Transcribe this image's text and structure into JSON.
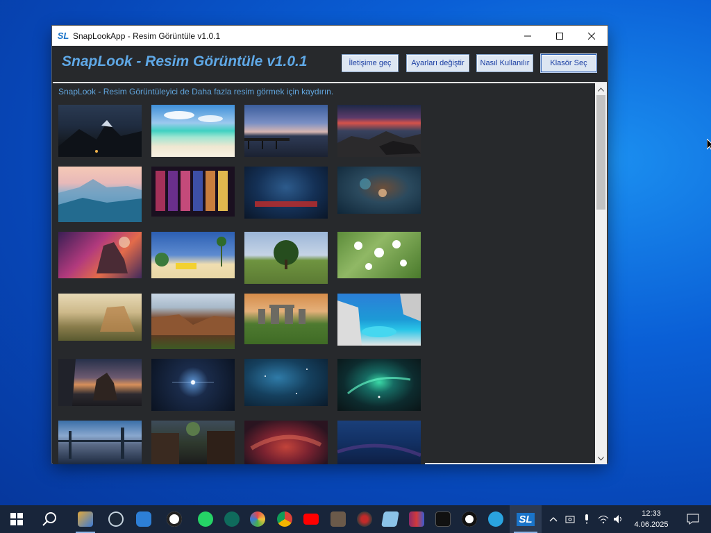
{
  "window": {
    "title": "SnapLookApp - Resim Görüntüle v1.0.1",
    "icon_text": "SL"
  },
  "header": {
    "title": "SnapLook - Resim Görüntüle v1.0.1",
    "buttons": {
      "contact": "İletişime geç",
      "settings": "Ayarları değiştir",
      "howto": "Nasıl Kullanılır",
      "folder": "Klasör Seç"
    }
  },
  "content": {
    "info_text": "SnapLook - Resim Görüntüleyici de Daha fazla resim görmek için kaydırın."
  },
  "gallery": [
    {
      "name": "mountain-night-image"
    },
    {
      "name": "tropical-beach-image"
    },
    {
      "name": "pier-sunset-image"
    },
    {
      "name": "rocky-shore-sunset-image"
    },
    {
      "name": "misty-mountains-image"
    },
    {
      "name": "neon-doors-image"
    },
    {
      "name": "blue-abyss-image"
    },
    {
      "name": "space-nebula-figure-image"
    },
    {
      "name": "fantasy-planet-image"
    },
    {
      "name": "palm-beach-car-image"
    },
    {
      "name": "green-tree-field-image"
    },
    {
      "name": "white-blossoms-image"
    },
    {
      "name": "canyon-painting-image"
    },
    {
      "name": "red-canyon-image"
    },
    {
      "name": "stonehenge-image"
    },
    {
      "name": "navagio-beach-image"
    },
    {
      "name": "dragon-canyon-image"
    },
    {
      "name": "blue-star-image"
    },
    {
      "name": "dark-nebula-image"
    },
    {
      "name": "green-nebula-image"
    },
    {
      "name": "futuristic-city-image"
    },
    {
      "name": "old-town-street-image"
    },
    {
      "name": "red-nebula-image"
    },
    {
      "name": "deep-blue-space-image"
    }
  ],
  "taskbar": {
    "time": "12:33",
    "date": "4.06.2025"
  },
  "colors": {
    "app_bg": "#27292c",
    "accent": "#5fa8e6",
    "button_bg": "#dde6f2",
    "button_text": "#1a3ea3"
  }
}
